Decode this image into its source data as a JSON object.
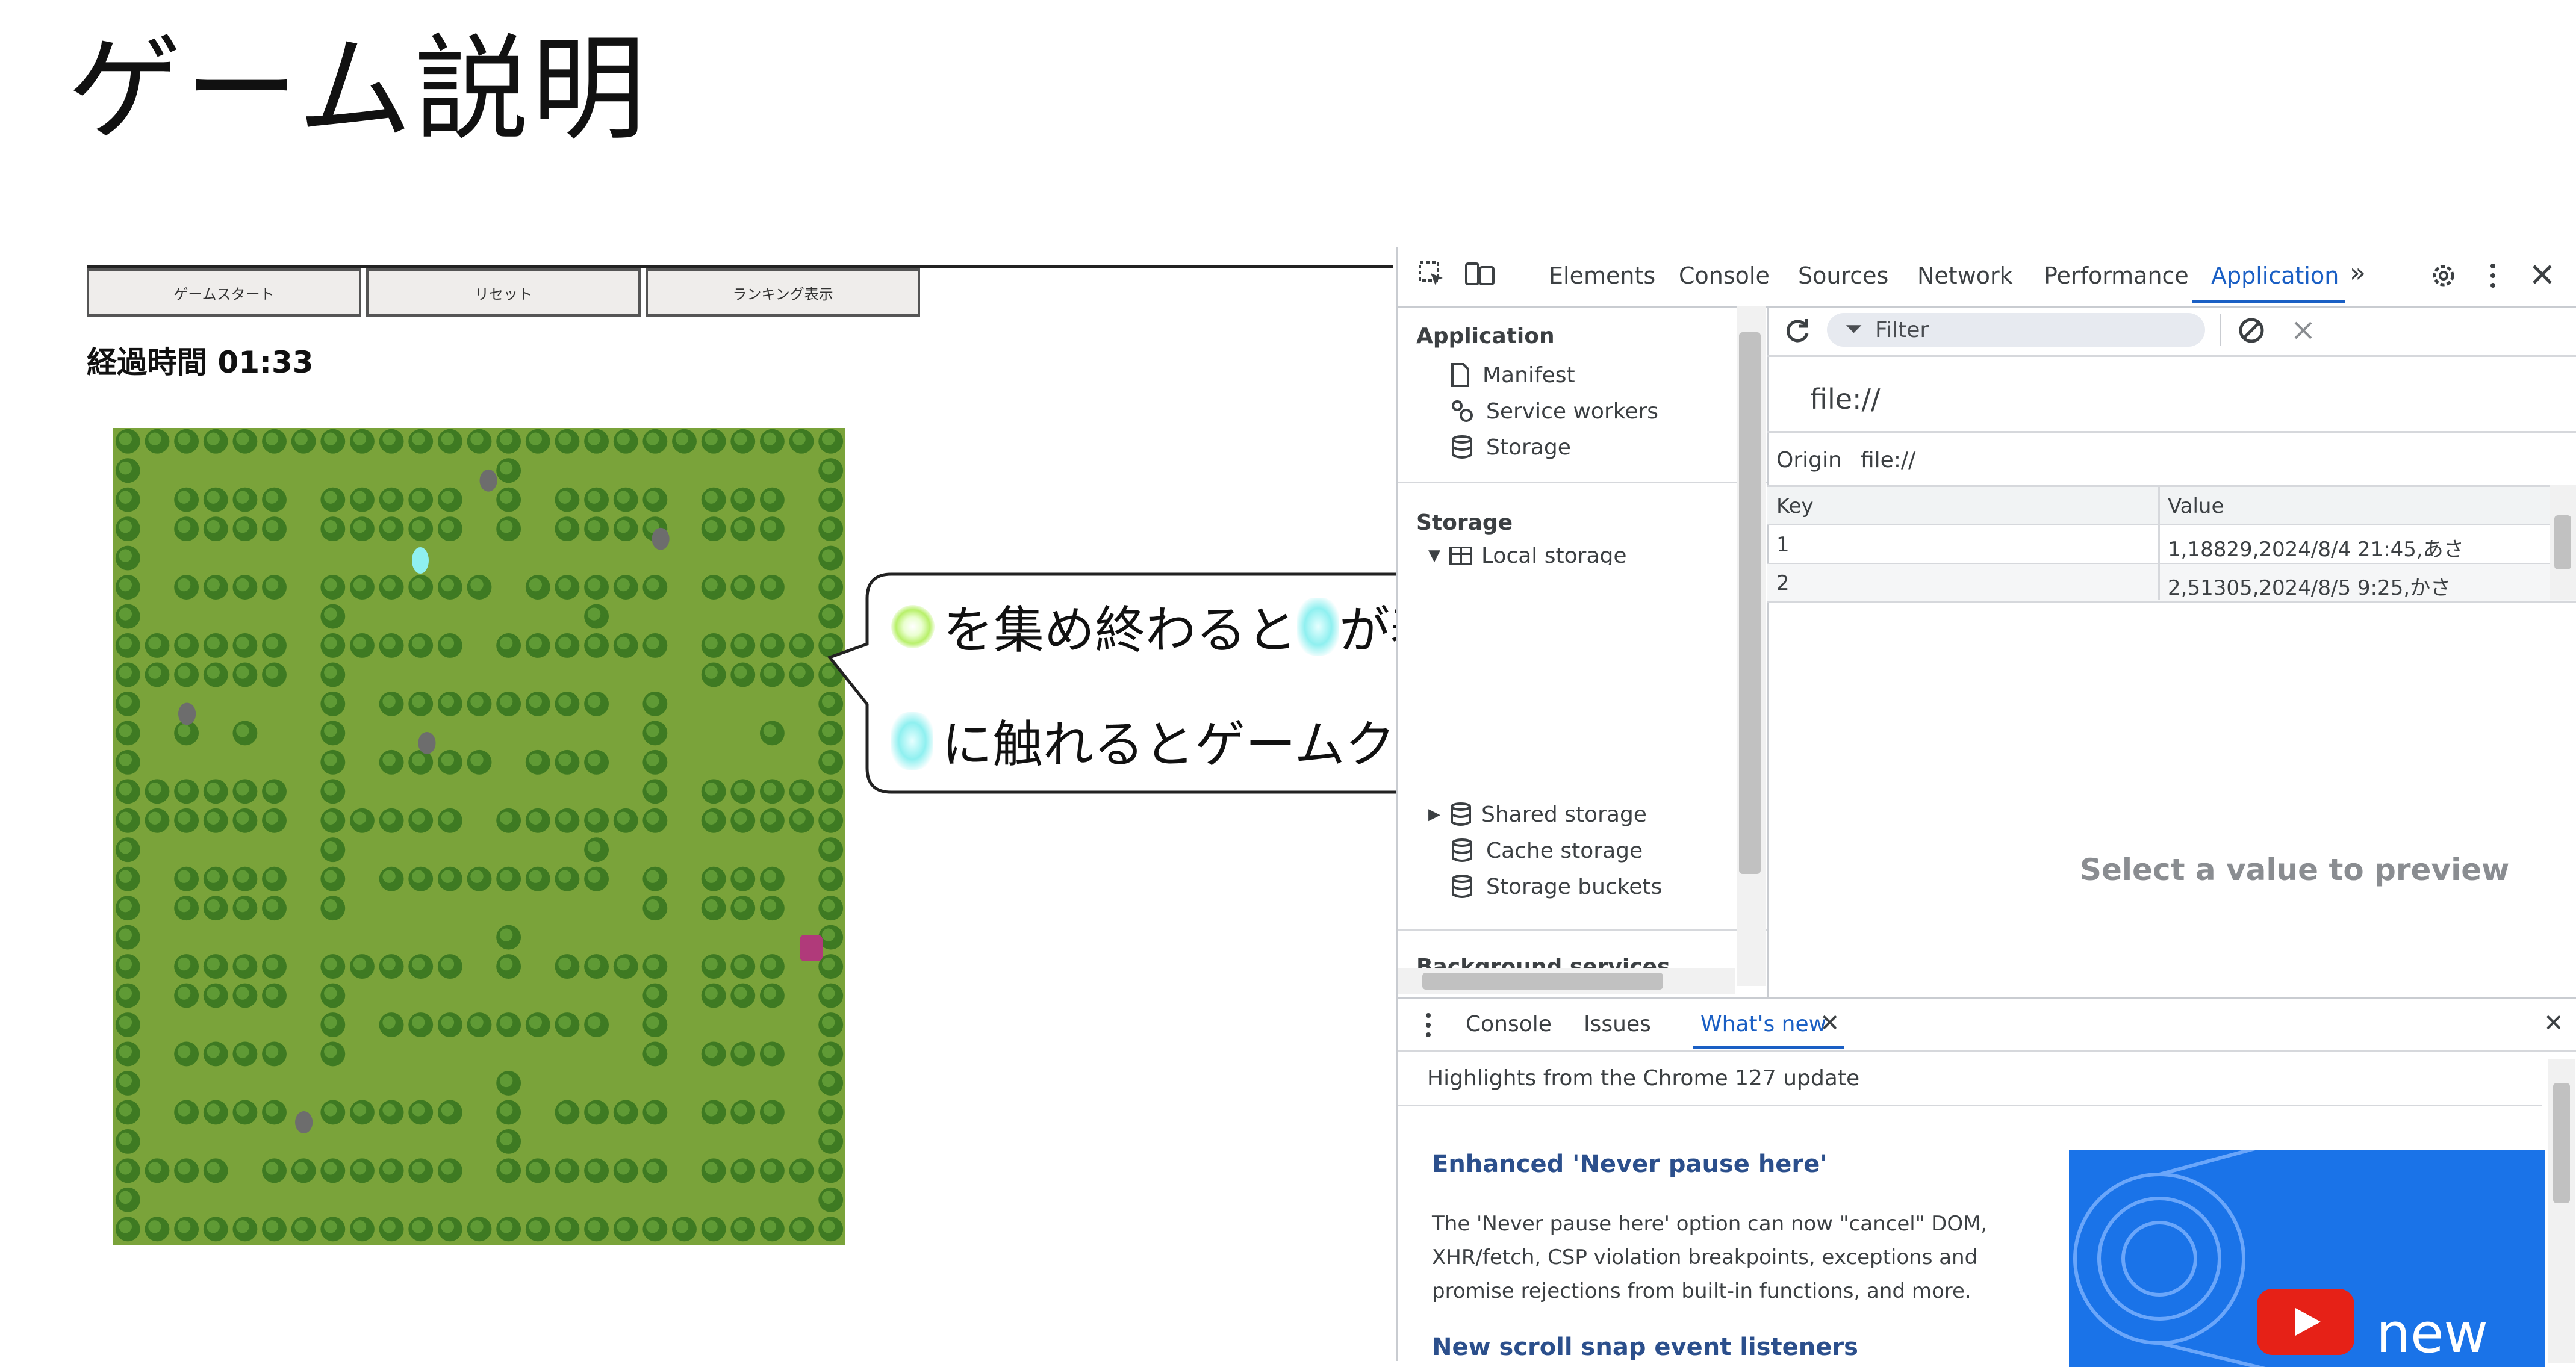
{
  "slide": {
    "title": "ゲーム説明"
  },
  "game": {
    "buttons": [
      "ゲームスタート",
      "リセット",
      "ランキング表示"
    ],
    "elapsed_label": "経過時間 01:33",
    "colors": {
      "grass": "#7aa33a",
      "tree": "#3e7a22",
      "tree_light": "#5f9a35"
    }
  },
  "bubble": {
    "line1": "を集め終わると",
    "line1b": "が表示されます",
    "line2": "に触れるとゲームクリアとなります",
    "icons": [
      "green-orb-icon",
      "cyan-crystal-icon"
    ]
  },
  "devtools": {
    "tabs": [
      "Elements",
      "Console",
      "Sources",
      "Network",
      "Performance",
      "Application"
    ],
    "active_tab": "Application",
    "sidebar": {
      "application_heading": "Application",
      "application_items": [
        "Manifest",
        "Service workers",
        "Storage"
      ],
      "storage_heading": "Storage",
      "storage_items": [
        "Local storage",
        "Shared storage",
        "Cache storage",
        "Storage buckets"
      ],
      "truncated_item": "Background services"
    },
    "filter_placeholder": "Filter",
    "origin_url": "file://",
    "origin_label": "Origin",
    "origin_value": "file://",
    "table": {
      "headers": [
        "Key",
        "Value"
      ],
      "rows": [
        {
          "key": "1",
          "value": "1,18829,2024/8/4 21:45,あさ"
        },
        {
          "key": "2",
          "value": "2,51305,2024/8/5 9:25,かさ"
        }
      ]
    },
    "preview_text": "Select a value to preview",
    "drawer": {
      "tabs": [
        "Console",
        "Issues",
        "What's new"
      ],
      "active_tab": "What's new",
      "highlights": "Highlights from the Chrome 127 update",
      "articles": [
        {
          "title": "Enhanced 'Never pause here'",
          "body": "The 'Never pause here' option can now \"cancel\" DOM, XHR/fetch, CSP violation breakpoints, exceptions and promise rejections from built-in functions, and more."
        },
        {
          "title": "New scroll snap event listeners",
          "body": ""
        }
      ],
      "promo_label": "new"
    },
    "accent": "#1a5fc4"
  }
}
